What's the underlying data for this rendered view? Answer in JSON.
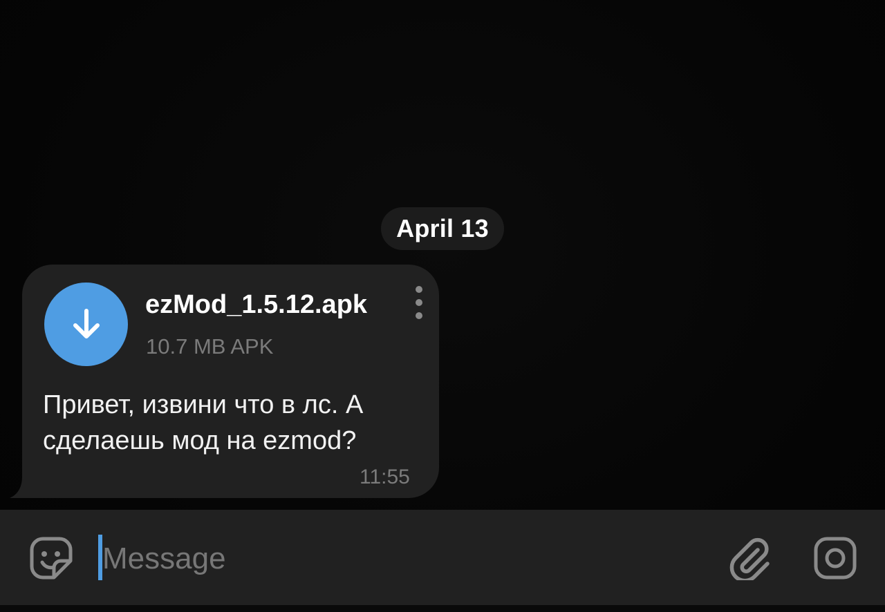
{
  "date_separator": "April 13",
  "message": {
    "file": {
      "name": "ezMod_1.5.12.apk",
      "meta": "10.7 MB APK",
      "icon": "download-arrow-icon"
    },
    "text": "Привет, извини что в лс. А сделаешь мод на ezmod?",
    "time": "11:55"
  },
  "composer": {
    "placeholder": "Message",
    "value": "",
    "emoji_icon": "sticker-smile-icon",
    "attach_icon": "paperclip-icon",
    "camera_icon": "camera-icon"
  },
  "colors": {
    "background": "#060606",
    "bubble": "#212121",
    "accent": "#4f9de3",
    "secondary_text": "#7b7b7b"
  }
}
